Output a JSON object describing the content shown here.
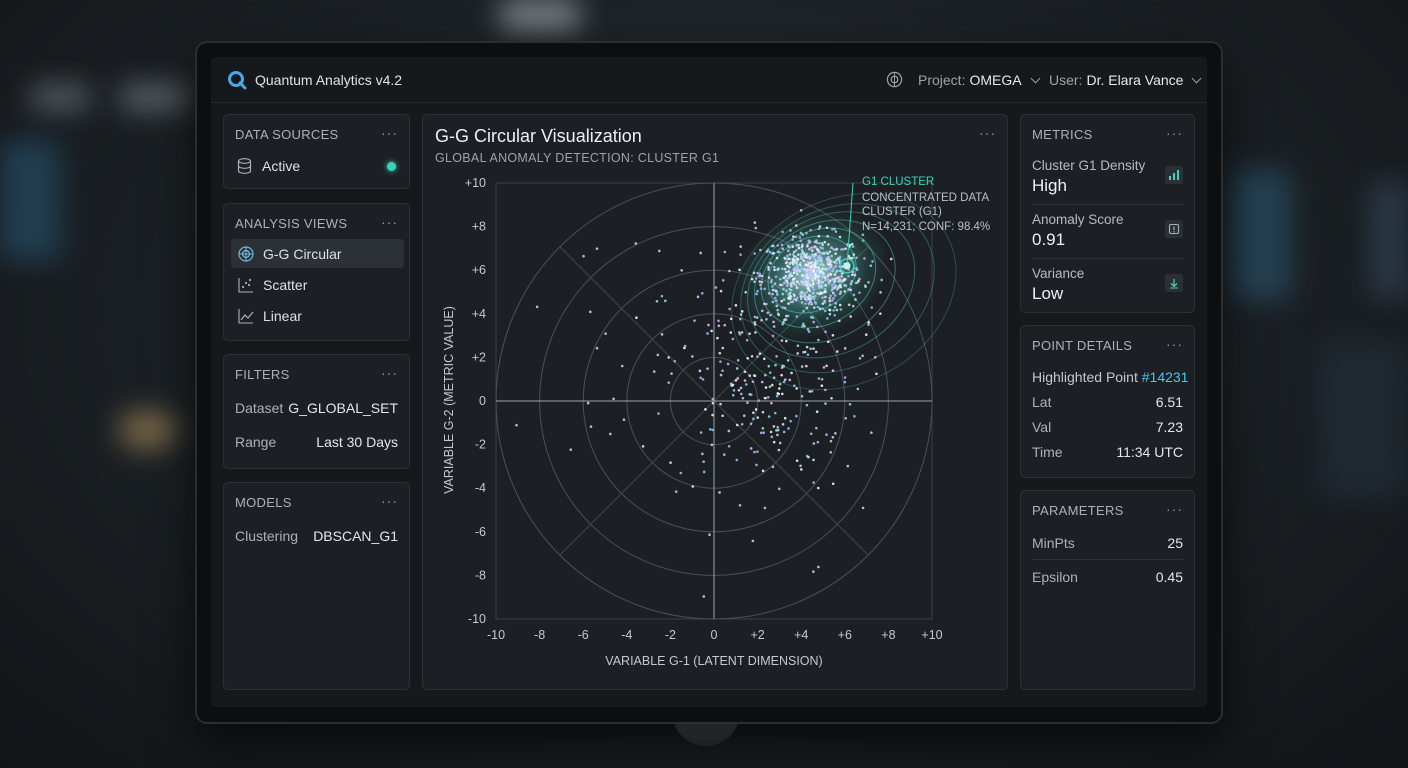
{
  "app": {
    "title": "Quantum Analytics v4.2"
  },
  "header": {
    "project_label": "Project:",
    "project_value": "OMEGA",
    "user_label": "User:",
    "user_value": "Dr. Elara Vance"
  },
  "data_sources": {
    "title": "DATA SOURCES",
    "menu": "···",
    "status_label": "Active",
    "status_color": "#3fd1b8"
  },
  "analysis_views": {
    "title": "ANALYSIS VIEWS",
    "menu": "···",
    "items": [
      {
        "label": "G-G Circular",
        "icon": "circular-grid-icon",
        "active": true
      },
      {
        "label": "Scatter",
        "icon": "scatter-icon",
        "active": false
      },
      {
        "label": "Linear",
        "icon": "line-chart-icon",
        "active": false
      }
    ]
  },
  "filters": {
    "title": "FILTERS",
    "menu": "···",
    "dataset_label": "Dataset",
    "dataset_value": "G_GLOBAL_SET",
    "range_label": "Range",
    "range_value": "Last 30 Days"
  },
  "models": {
    "title": "MODELS",
    "menu": "···",
    "clustering_label": "Clustering",
    "clustering_value": "DBSCAN_G1"
  },
  "chart_panel": {
    "title": "G-G Circular Visualization",
    "subtitle": "GLOBAL ANOMALY DETECTION: CLUSTER G1",
    "menu": "···"
  },
  "chart_data": {
    "type": "scatter",
    "title": "G-G Circular Visualization",
    "subtitle": "GLOBAL ANOMALY DETECTION: CLUSTER G1",
    "xlabel": "VARIABLE G-1 (LATENT DIMENSION)",
    "ylabel": "VARIABLE G-2 (METRIC VALUE)",
    "xlim": [
      -10,
      10
    ],
    "ylim": [
      -10,
      10
    ],
    "x_ticks": [
      "-10",
      "-8",
      "-6",
      "-4",
      "-2",
      "0",
      "+2",
      "+4",
      "+6",
      "+8",
      "+10"
    ],
    "y_ticks": [
      "+10",
      "+8",
      "+6",
      "+4",
      "+2",
      "0",
      "-2",
      "-4",
      "-6",
      "-8",
      "-10"
    ],
    "polar_rings": [
      2,
      4,
      6,
      8,
      10
    ],
    "grid": true,
    "cluster": {
      "name": "G1",
      "center": [
        4.5,
        5.8
      ],
      "highlight_point": [
        6.1,
        6.2
      ]
    },
    "annotation": {
      "title": "G1 CLUSTER",
      "line1": "CONCENTRATED DATA",
      "line2": "CLUSTER (G1)",
      "line3": "N=14,231; CONF: 98.4%"
    },
    "accent_color": "#3fd1b8"
  },
  "metrics": {
    "title": "METRICS",
    "menu": "···",
    "items": [
      {
        "label": "Cluster G1 Density",
        "value": "High",
        "icon": "bar-chart-icon"
      },
      {
        "label": "Anomaly Score",
        "value": "0.91",
        "icon": "alert-icon"
      },
      {
        "label": "Variance",
        "value": "Low",
        "icon": "trend-down-icon"
      }
    ]
  },
  "point_details": {
    "title": "POINT DETAILS",
    "menu": "···",
    "highlight_label": "Highlighted Point",
    "highlight_id": "#14231",
    "lat_label": "Lat",
    "lat_value": "6.51",
    "val_label": "Val",
    "val_value": "7.23",
    "time_label": "Time",
    "time_value": "11:34 UTC"
  },
  "parameters": {
    "title": "PARAMETERS",
    "menu": "···",
    "minpts_label": "MinPts",
    "minpts_value": "25",
    "epsilon_label": "Epsilon",
    "epsilon_value": "0.45"
  }
}
